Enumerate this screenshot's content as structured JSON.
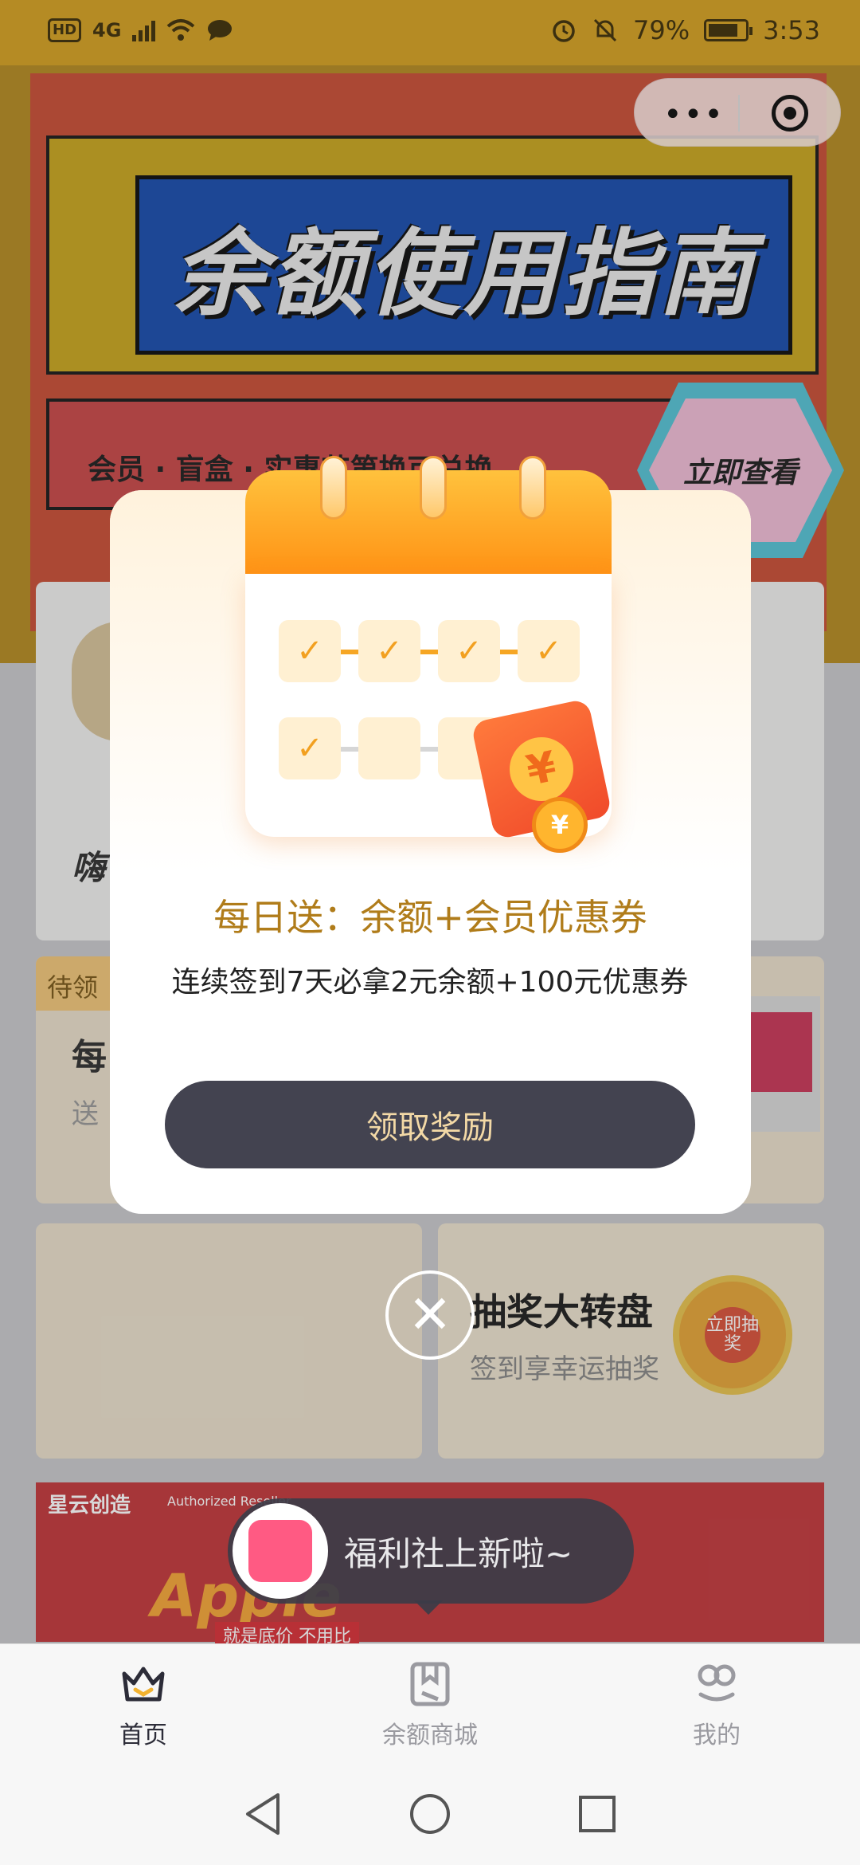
{
  "status_bar": {
    "left_badges": [
      "HD",
      "4G"
    ],
    "battery": "79%",
    "time": "3:53"
  },
  "capsule": {
    "more_label": "•••"
  },
  "banner": {
    "title": "余额使用指南",
    "subtitle": "会员 · 盲盒 · 实惠节第换可兑换",
    "cta": "立即查看"
  },
  "background_cards": {
    "task_tag": "待领",
    "task_title": "每",
    "task_sub": "送",
    "lottery_title": "抽奖大转盘",
    "lottery_sub": "签到享幸运抽奖",
    "lottery_badge": "立即抽奖",
    "ad_brand": "星云创造",
    "ad_reseller": "Authorized Reseller",
    "ad_big": "Apple",
    "ad_price": "就是底价 不用比"
  },
  "modal": {
    "title": "每日送：余额+会员优惠券",
    "description": "连续签到7天必拿2元余额+100元优惠券",
    "claim_button": "领取奖励",
    "currency_symbol": "¥",
    "close_symbol": "✕"
  },
  "toast": {
    "text": "福利社上新啦~"
  },
  "tabbar": {
    "items": [
      {
        "label": "首页",
        "icon": "crown-icon",
        "active": true
      },
      {
        "label": "余额商城",
        "icon": "bookmark-icon",
        "active": false
      },
      {
        "label": "我的",
        "icon": "profile-icon",
        "active": false
      }
    ]
  },
  "colors": {
    "accent_gold": "#b07c1a",
    "button_dark": "#434350",
    "calendar_orange": "#ff8f12",
    "status_bar": "#b58b24"
  }
}
